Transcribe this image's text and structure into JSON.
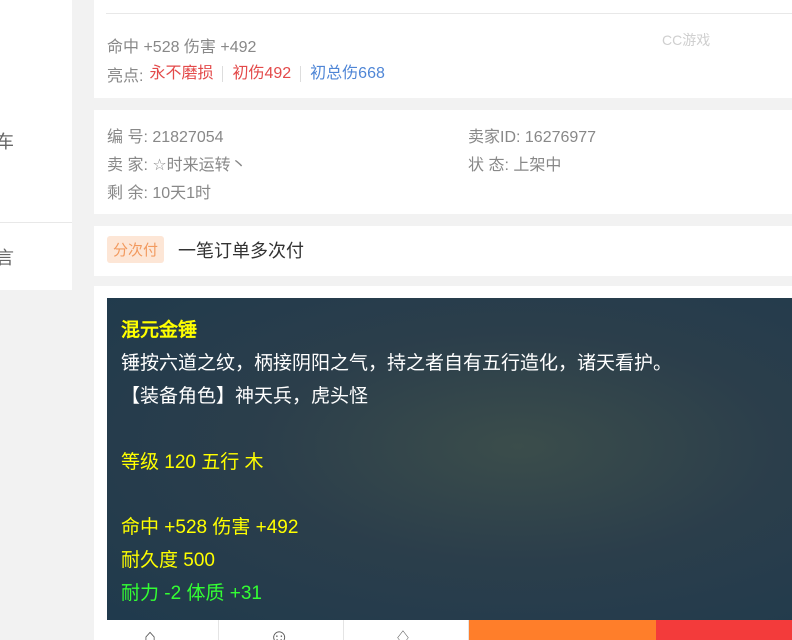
{
  "left_nav": {
    "item1": "车",
    "item2": "言"
  },
  "stats": {
    "line": "命中 +528 伤害 +492",
    "highlights_label": "亮点:",
    "highlights": [
      "永不磨损",
      "初伤492",
      "初总伤668"
    ],
    "watermark": "CC游戏"
  },
  "info": {
    "number": "编 号: 21827054",
    "seller": "卖 家: ☆时来运转丶",
    "remaining": "剩 余: 10天1时",
    "seller_id": "卖家ID: 16276977",
    "status": "状 态: 上架中"
  },
  "payment": {
    "badge": "分次付",
    "text": "一笔订单多次付"
  },
  "item_desc": {
    "name": "混元金锤",
    "desc": "锤按六道之纹，柄接阴阳之气，持之者自有五行造化，诸天看护。",
    "role": "【装备角色】神天兵，虎头怪",
    "level": "等级 120  五行 木",
    "attack": "命中 +528 伤害 +492",
    "durability": "耐久度 500",
    "attrs": "耐力 -2 体质 +31"
  },
  "colors": {
    "orange": "#ff7e2a",
    "red": "#f33b3b",
    "desc_yellow": "#ffff00",
    "desc_green": "#33ff33"
  }
}
